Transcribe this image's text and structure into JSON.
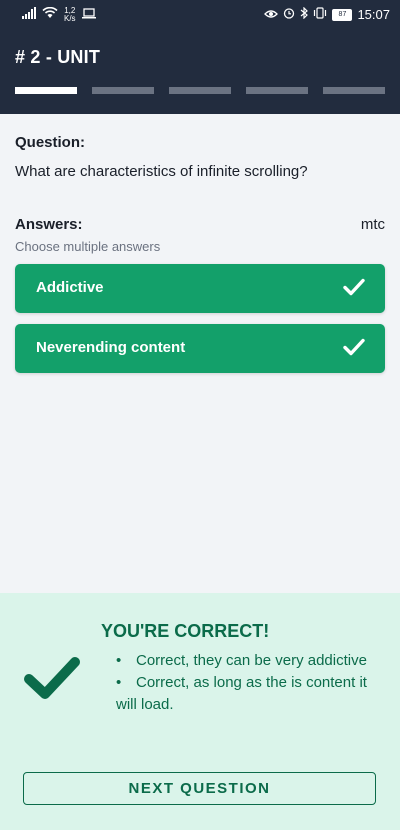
{
  "status_bar": {
    "speed_value": "1,2",
    "speed_unit": "K/s",
    "battery": "87",
    "time": "15:07",
    "icons": [
      "signal-icon",
      "wifi-icon",
      "laptop-icon",
      "eye-icon",
      "alarm-icon",
      "bluetooth-icon",
      "vibrate-icon",
      "battery-icon"
    ]
  },
  "header": {
    "title": "# 2 - UNIT",
    "progress": {
      "total": 5,
      "current": 1
    }
  },
  "question": {
    "label": "Question:",
    "text": "What are characteristics of infinite scrolling?"
  },
  "answers": {
    "label": "Answers:",
    "type_code": "mtc",
    "hint": "Choose multiple answers",
    "items": [
      {
        "label": "Addictive",
        "selected": true
      },
      {
        "label": "Neverending content",
        "selected": true
      }
    ]
  },
  "feedback": {
    "title": "YOU'RE CORRECT!",
    "explanations": [
      "Correct, they can be very addictive",
      "Correct, as long as the is content it will load."
    ],
    "next_button": "NEXT QUESTION"
  },
  "colors": {
    "header_bg": "#222c3e",
    "progress_active": "#ffffff",
    "progress_inactive": "#6b7382",
    "answer_bg": "#13a06a",
    "feedback_bg": "#daf4ea",
    "feedback_text": "#0b6b4a"
  }
}
